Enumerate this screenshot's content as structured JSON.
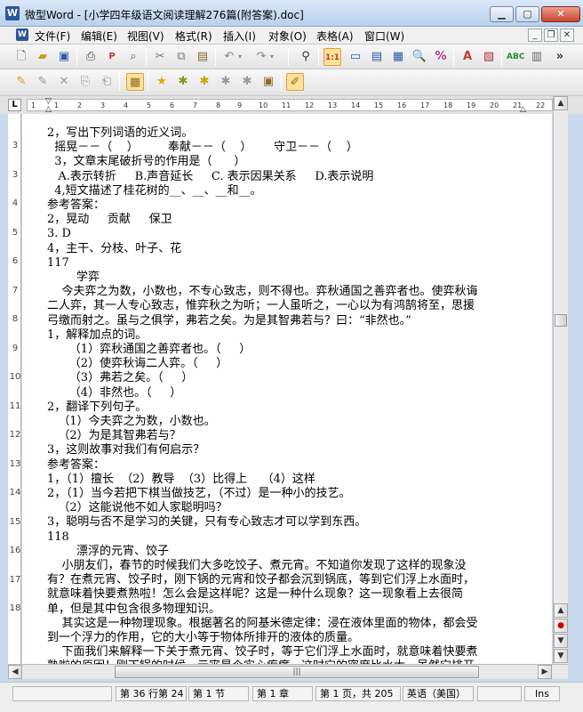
{
  "window": {
    "title": "微型Word - [小学四年级语文阅读理解276篇(附答案).doc]",
    "app_icon_letter": "W"
  },
  "menu": [
    "文件(F)",
    "编辑(E)",
    "视图(V)",
    "格式(R)",
    "插入(I)",
    "对象(O)",
    "表格(A)",
    "窗口(W)"
  ],
  "vruler_numbers": [
    "3",
    "3",
    "4",
    "5",
    "6",
    "7",
    "8",
    "9",
    "10",
    "11",
    "12",
    "13",
    "14",
    "15",
    "16",
    "17",
    "18"
  ],
  "document_lines": [
    "2，写出下列词语的近义词。",
    "  摇晃－－（    ）        奉献－－（    ）      守卫－－（    ）",
    "  3，文章末尾破折号的作用是（      ）",
    "   A.表示转折     B.声音延长     C. 表示因果关系     D.表示说明",
    "  4,短文描述了桂花树的__、__、__和__。",
    "参考答案：",
    "2，晃动     贡献     保卫",
    "3. D",
    "4，主干、分枝、叶子、花",
    "117",
    "        学弈",
    "    今夫弈之为数，小数也，不专心致志，则不得也。弈秋通国之善弈者也。使弈秋诲",
    "二人弈，其一人专心致志，惟弈秋之为听；一人虽听之，一心以为有鸿鹄将至，思援",
    "弓缴而射之。虽与之俱学，弗若之矣。为是其智弗若与？曰：“非然也。”",
    "1，解释加点的词。",
    "      （1）弈秋通国之善弈者也。（     ）",
    "      （2）使弈秋诲二人弈。（     ）",
    "      （3）弗若之矣。（     ）",
    "      （4）非然也。（     ）",
    "2，翻译下列句子。",
    "   （1）今夫弈之为数，小数也。",
    "   （2）为是其智弗若与？",
    "3，这则故事对我们有何启示？",
    "参考答案：",
    "1，（1）擅长  （2）教导  （3）比得上    （4）这样",
    "2，（1）当今若把下棋当做技艺，（不过）是一种小的技艺。",
    "   （2）这能说他不如人家聪明吗？",
    "3，聪明与否不是学习的关键，只有专心致志才可以学到东西。",
    "118",
    "        漂浮的元宵、饺子",
    "    小朋友们，春节的时候我们大多吃饺子、煮元宵。不知道你发现了这样的现象没",
    "有？在煮元宵、饺子时，刚下锅的元宵和饺子都会沉到锅底，等到它们浮上水面时，",
    "就意味着快要煮熟啦！怎么会是这样呢？这是一种什么现象？这一现象看上去很简",
    "单，但是其中包含很多物理知识。",
    "    其实这是一种物理现象。根据著名的阿基米德定律：浸在液体里面的物体，都会受",
    "到一个浮力的作用，它的大小等于物体所排开的液体的质量。",
    "    下面我们来解释一下关于煮元宵、饺子时，等于它们浮上水面时，就意味着快要煮",
    "熟啦的原因！刚下锅的时候，元宵是个实心疙瘩，这时它的密度比水大。虽然它排开"
  ],
  "status": {
    "position": "第 36 行第 24",
    "section": "第 1 节",
    "chapter": "第 1 章",
    "page": "第 1 页，共 205",
    "language": "英语（美国）",
    "mode": "Ins"
  },
  "toolbar_icons": [
    "new",
    "open",
    "save",
    "print",
    "pdf",
    "preview",
    "cut",
    "copy",
    "paste",
    "undo",
    "redo",
    "find",
    "page-view",
    "outline-view",
    "normal-view",
    "web-view",
    "zoom",
    "replace",
    "text-color",
    "insert-object",
    "spellcheck",
    "chart",
    "more"
  ],
  "toolbar2_icons": [
    "tool-a",
    "tool-b",
    "tool-c",
    "tool-d",
    "tool-e",
    "object-button",
    "star-a",
    "star-b",
    "star-c",
    "star-d",
    "star-e",
    "edit-box",
    "marker"
  ]
}
